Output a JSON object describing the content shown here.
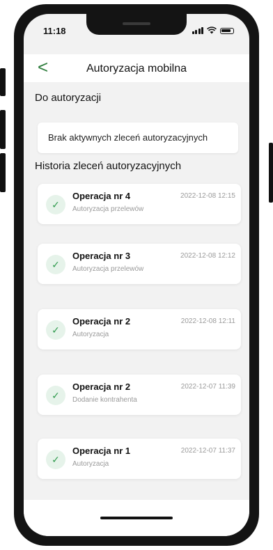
{
  "status_bar": {
    "time": "11:18"
  },
  "header": {
    "title": "Autoryzacja mobilna",
    "back_icon": "<"
  },
  "pending": {
    "section_title": "Do autoryzacji",
    "empty_message": "Brak aktywnych zleceń autoryzacyjnych"
  },
  "history": {
    "section_title": "Historia zleceń autoryzacyjnych",
    "items": [
      {
        "name": "Operacja nr 4",
        "type": "Autoryzacja przelewów",
        "date": "2022-12-08 12:15"
      },
      {
        "name": "Operacja nr 3",
        "type": "Autoryzacja przelewów",
        "date": "2022-12-08 12:12"
      },
      {
        "name": "Operacja nr 2",
        "type": "Autoryzacja",
        "date": "2022-12-08 12:11"
      },
      {
        "name": "Operacja nr 2",
        "type": "Dodanie kontrahenta",
        "date": "2022-12-07 11:39"
      },
      {
        "name": "Operacja nr 1",
        "type": "Autoryzacja",
        "date": "2022-12-07 11:37"
      }
    ]
  },
  "colors": {
    "accent": "#2e7d3c",
    "check_bg": "#e6f3ea",
    "background": "#f2f2f2"
  },
  "icons": {
    "item_status": "check-icon"
  }
}
